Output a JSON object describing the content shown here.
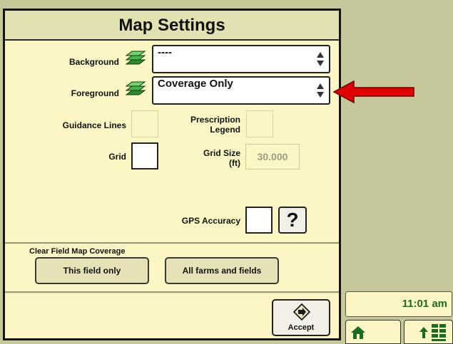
{
  "dialog": {
    "title": "Map Settings",
    "background": {
      "label": "Background",
      "value": "----",
      "icon": "layers-icon"
    },
    "foreground": {
      "label": "Foreground",
      "value": "Coverage Only",
      "icon": "layers-icon"
    },
    "guidance_lines": {
      "label": "Guidance Lines",
      "checked": false,
      "enabled": false
    },
    "prescription_legend": {
      "label_line1": "Prescription",
      "label_line2": "Legend",
      "checked": false,
      "enabled": false
    },
    "grid": {
      "label": "Grid",
      "checked": false
    },
    "grid_size": {
      "label_line1": "Grid Size",
      "label_line2": "(ft)",
      "value": "30.000",
      "enabled": false
    },
    "gps_accuracy": {
      "label": "GPS Accuracy",
      "checked": false
    },
    "help_button": {
      "label": "?"
    },
    "clear_coverage": {
      "title": "Clear Field Map Coverage",
      "this_field_label": "This field only",
      "all_fields_label": "All farms and fields"
    },
    "accept_label": "Accept"
  },
  "status": {
    "time": "11:01 am"
  },
  "annotation": {
    "arrow_color": "#e30000"
  },
  "colors": {
    "panel_bg": "#fbf6c4",
    "desktop_bg": "#c7c89a",
    "title_bg": "#e3e1b2",
    "layers_green": "#2b8a2b",
    "clock_text": "#1a6c23"
  }
}
